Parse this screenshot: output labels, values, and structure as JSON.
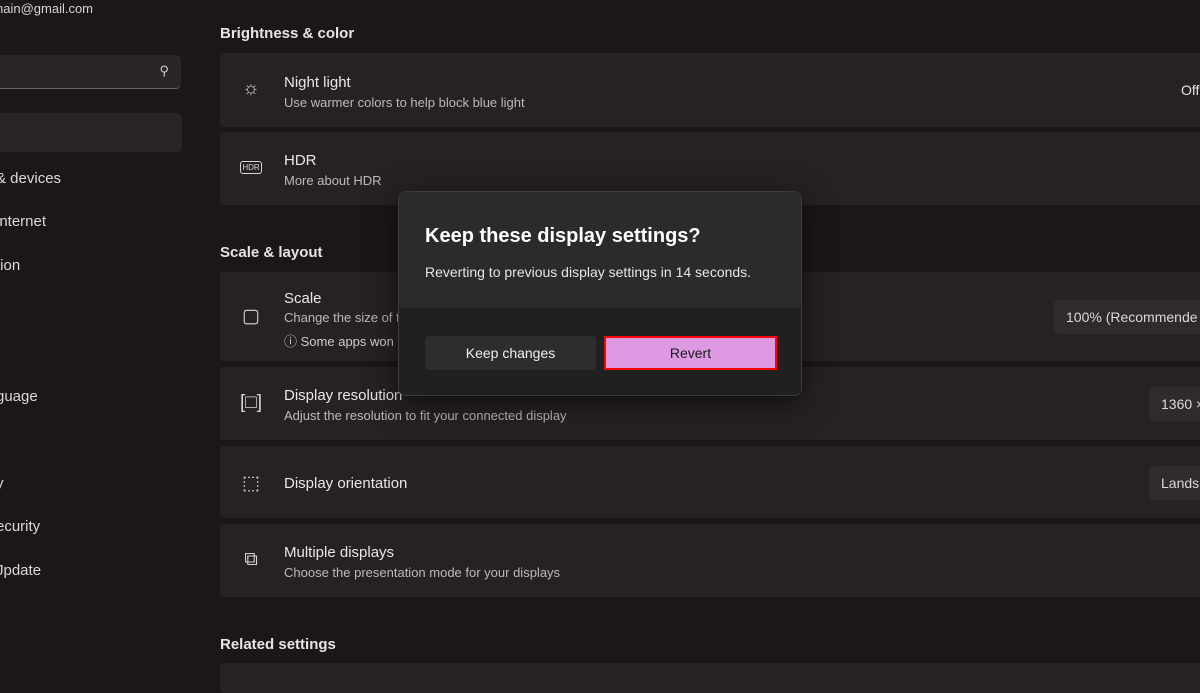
{
  "sidebar": {
    "email": "hain@gmail.com",
    "search_icon": "search-icon",
    "items": [
      "& devices",
      " internet",
      "tion",
      "guage",
      "y",
      "ecurity",
      "Jpdate"
    ]
  },
  "sections": {
    "brightness": "Brightness & color",
    "scale": "Scale & layout",
    "related": "Related settings"
  },
  "cards": {
    "night": {
      "title": "Night light",
      "sub": "Use warmer colors to help block blue light",
      "value": "Off"
    },
    "hdr": {
      "title": "HDR",
      "sub": "More about HDR",
      "icon_text": "HDR"
    },
    "scale": {
      "title": "Scale",
      "sub": "Change the size of t",
      "note": "Some apps won",
      "value": "100% (Recommende"
    },
    "resolution": {
      "title": "Display resolution",
      "sub": "Adjust the resolution to fit your connected display",
      "value": "1360 ×"
    },
    "orientation": {
      "title": "Display orientation",
      "value": "Lands"
    },
    "multiple": {
      "title": "Multiple displays",
      "sub": "Choose the presentation mode for your displays"
    }
  },
  "dialog": {
    "title": "Keep these display settings?",
    "message": "Reverting to previous display settings in 14 seconds.",
    "keep_label": "Keep changes",
    "revert_label": "Revert"
  },
  "colors": {
    "revert": "#dd9ae2",
    "highlight": "#ff0000"
  }
}
